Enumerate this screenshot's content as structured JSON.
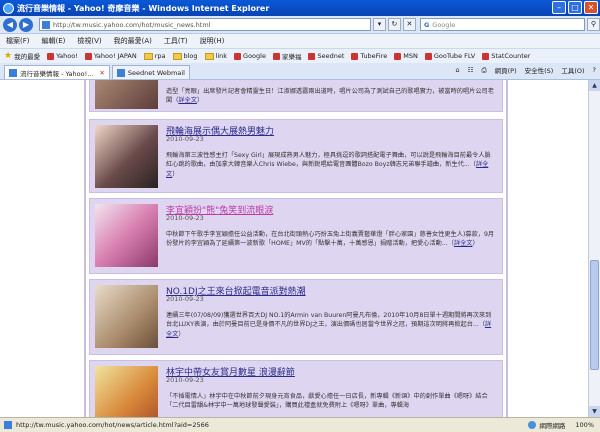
{
  "window": {
    "title": "流行音樂情報 - Yahoo! 奇摩音樂 - Windows Internet Explorer"
  },
  "address": {
    "url": "http://tw.music.yahoo.com/hot/music_news.html"
  },
  "search": {
    "placeholder": "Google"
  },
  "menu": [
    "檔案(F)",
    "編輯(E)",
    "檢視(V)",
    "我的最愛(A)",
    "工具(T)",
    "說明(H)"
  ],
  "favorites": {
    "label": "我的最愛",
    "items": [
      "Yahoo!",
      "Yahoo! JAPAN",
      "rpa",
      "blog",
      "link",
      "Google",
      "家樂福",
      "Seednet",
      "TubeFire",
      "MSN",
      "GooTube FLV",
      "StatCounter"
    ]
  },
  "tabs": [
    {
      "label": "流行音樂情報 - Yahoo!...",
      "active": true
    },
    {
      "label": "Seednet Webmail",
      "active": false
    }
  ],
  "tab_tools": {
    "page": "網頁(P)",
    "safety": "安全性(S)",
    "tools": "工具(O)"
  },
  "articles": [
    {
      "headline": "",
      "date": "",
      "snippet": "造型「亮眼」出席發片記者會精靈生日！江淑娜透露兩出道時，唱片公司為了測試自己的歌唱實力，被當時的唱片公司老闆",
      "more": "詳全文"
    },
    {
      "headline": "飛輪海展示偶大展熱男魅力",
      "date": "2010-09-23",
      "snippet": "飛輪海第三波性感主打「Sexy Girl」展現成熟男人魅力，極具挑逗的歌詞搭配電子舞曲，可以說是飛輪海目前最令人臉紅心跳的歌曲，由加拿大韓音樂人Chris Wiebe，與新銳唱給電音團體Bozo Boyz韓志兄弟聯手譜曲，新生代...",
      "more": "詳全文"
    },
    {
      "headline": "李宜穎扮\"熊\"兔笑到流眼淚",
      "date": "2010-09-23",
      "snippet": "中秋節下午歌手李宜穎擔任公益活動，在台北街頭熱心巧扮玉兔上街義賣藝華燈「胖心家園」慈善女性更生人)募款，9月份發片的李宜穎為了延續第一波新歌「HOME」MV的「點擊十萬，十萬感恩」捐贈活動，把愛心活動...",
      "more": "詳全文"
    },
    {
      "headline": "NO.1DJ之王來台掀起電音派對熱潮",
      "date": "2010-09-23",
      "snippet": "連續三年(07/08/09)獲選世界百大DJ NO.1的Armin van Buuren阿曼凡布倫，2010年10月8日單十週期間將再次來到台北LUXY表演，由於阿曼目前已是身價不凡的世界DJ之王，演出價碼也居當今世界之冠，預期這次明將再掀起台...",
      "more": "詳全文"
    },
    {
      "headline": "林宇中帶女友賞月數星 浪漫辭節",
      "date": "2010-09-23",
      "snippet": "「不插電情人」林宇中在中秋節前夕現身元宵食品，獻愛心擔任一日店長，新專輯《新頌》中的創作單曲《嗯呀》結合「二代目雷韻&林宇中一萬地球發聲愛裝」，購買此禮盒就免費附上《嗯呀》單曲，專輯海",
      "more": ""
    }
  ],
  "status": {
    "url": "http://tw.music.yahoo.com/hot/news/article.html?aid=2566",
    "zone": "網際網路",
    "zoom": "100%"
  }
}
